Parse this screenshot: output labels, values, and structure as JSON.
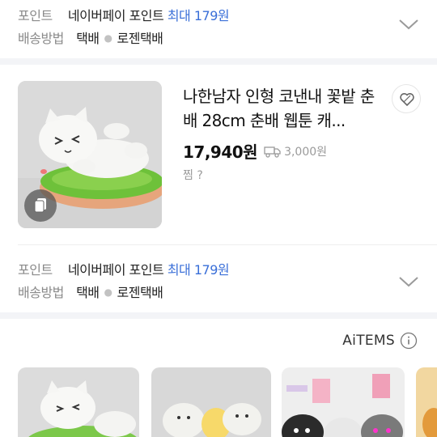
{
  "shipping_top": {
    "points_label": "포인트",
    "points_provider": "네이버페이 포인트",
    "points_max": "최대 179원",
    "ship_label": "배송방법",
    "ship_type": "택배",
    "ship_company": "로젠택배"
  },
  "product": {
    "title": "나한남자 인형 코낸내 꽃밭 춘배 28cm 춘배 웹툰 캐...",
    "price": "17,940원",
    "shipping_fee": "3,000원",
    "zzim": "찜 ?"
  },
  "shipping_bottom": {
    "points_label": "포인트",
    "points_provider": "네이버페이 포인트",
    "points_max": "최대 179원",
    "ship_label": "배송방법",
    "ship_type": "택배",
    "ship_company": "로젠택배"
  },
  "aitems": {
    "label": "AiTEMS"
  },
  "colors": {
    "accent_blue": "#3a6fd8",
    "muted": "#8a8a8a",
    "divider": "#f3f4f7"
  },
  "icons": [
    "chevron-down-icon",
    "copy-icon",
    "heart-icon",
    "truck-icon",
    "info-icon"
  ]
}
